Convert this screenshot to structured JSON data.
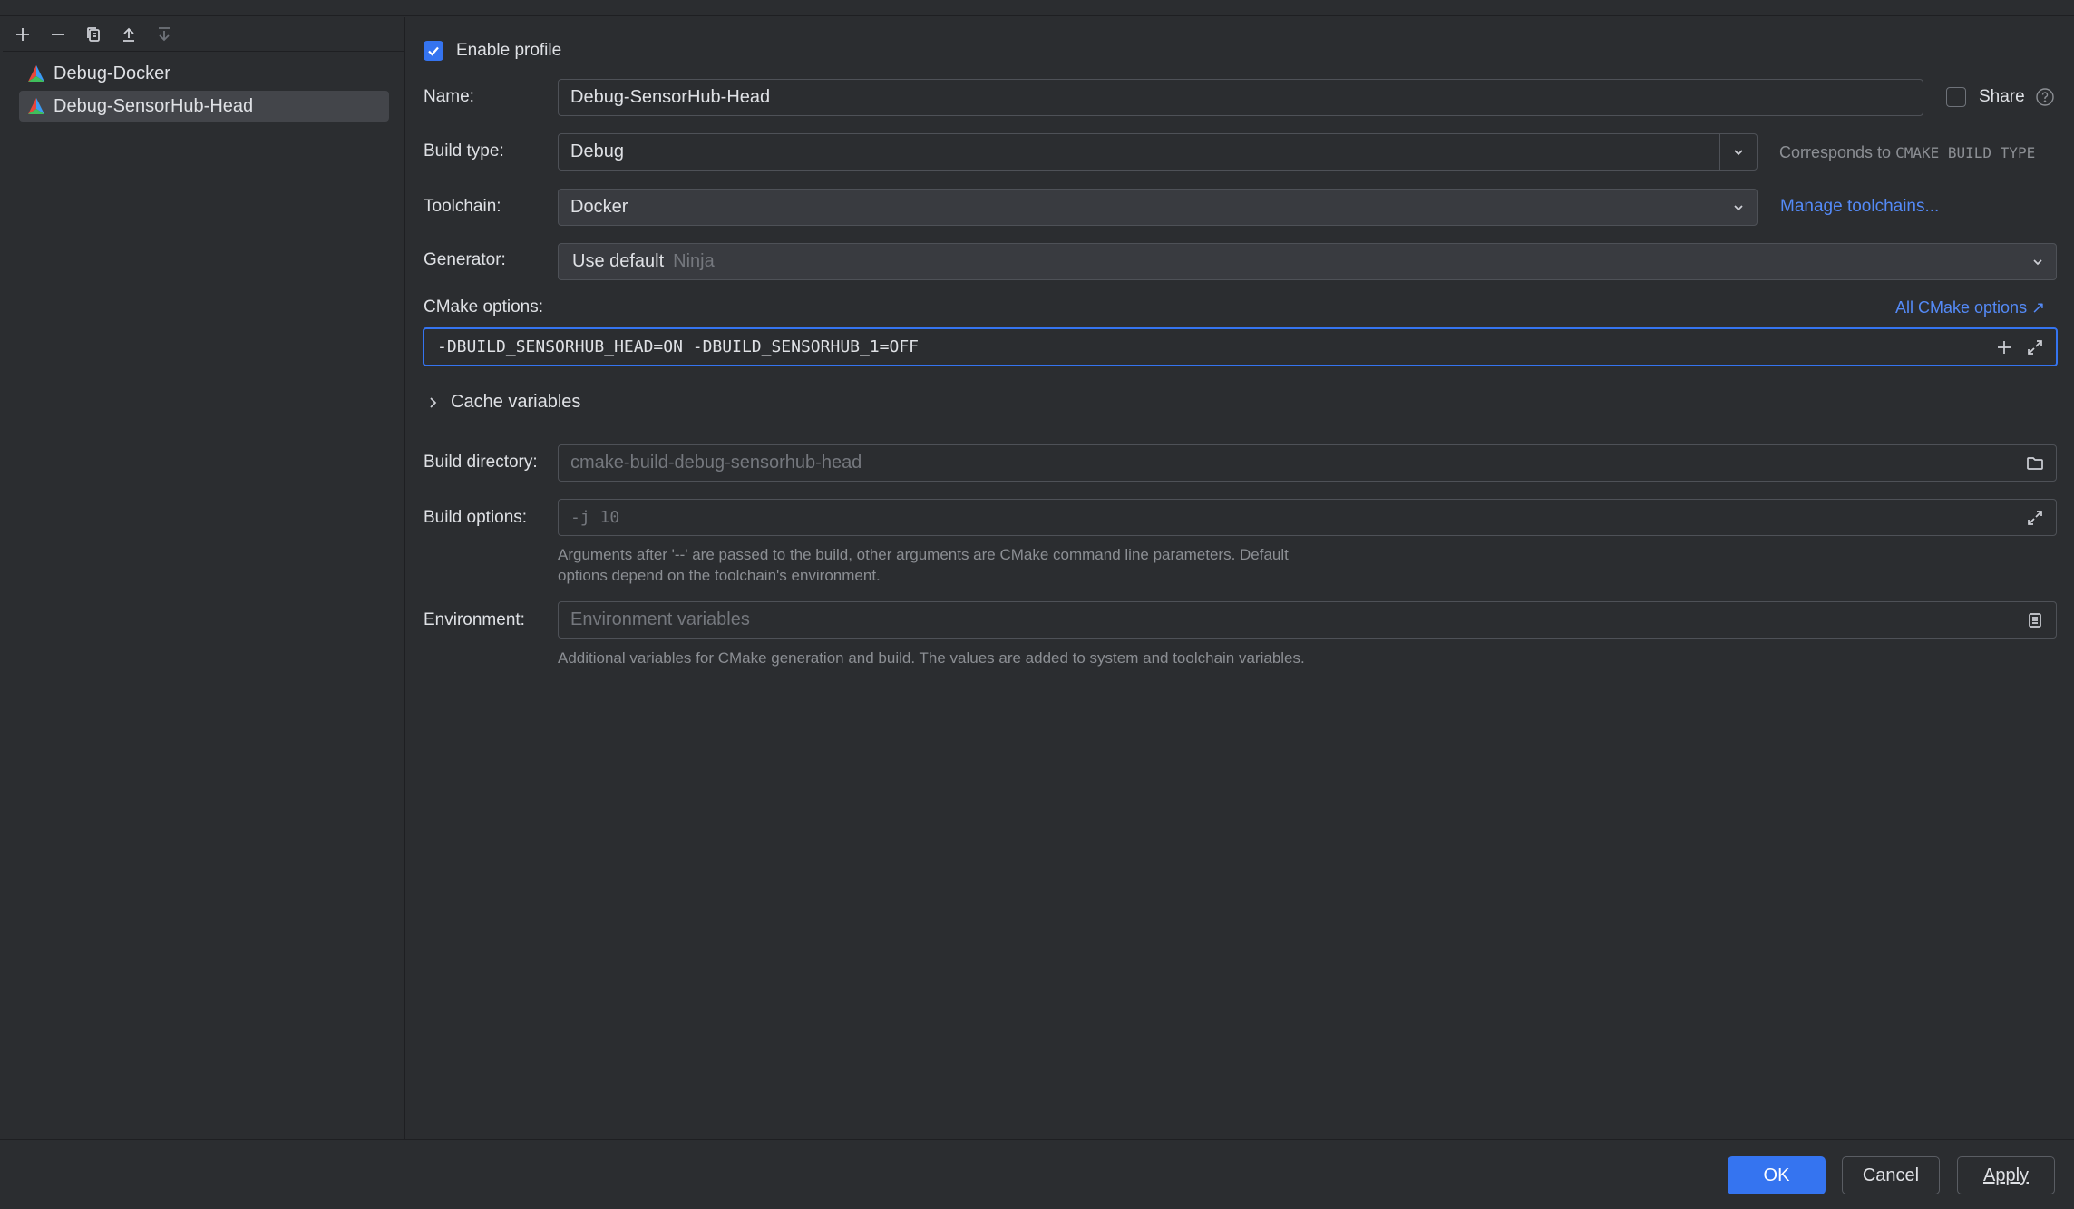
{
  "profiles": [
    {
      "label": "Debug-Docker",
      "selected": false
    },
    {
      "label": "Debug-SensorHub-Head",
      "selected": true
    }
  ],
  "toolbar": {
    "icons": [
      "add-icon",
      "remove-icon",
      "copy-icon",
      "move-up-icon",
      "move-down-icon"
    ]
  },
  "form": {
    "enable_profile_label": "Enable profile",
    "enable_profile_checked": true,
    "name_label": "Name:",
    "name_value": "Debug-SensorHub-Head",
    "share_label": "Share",
    "share_checked": false,
    "build_type_label": "Build type:",
    "build_type_value": "Debug",
    "build_type_hint_prefix": "Corresponds to ",
    "build_type_hint_code": "CMAKE_BUILD_TYPE",
    "toolchain_label": "Toolchain:",
    "toolchain_value": "Docker",
    "manage_toolchains_link": "Manage toolchains...",
    "generator_label": "Generator:",
    "generator_value": "Use default",
    "generator_default": "Ninja",
    "cmake_options_label": "CMake options:",
    "all_cmake_options_link": "All CMake options ↗",
    "cmake_options_value": "-DBUILD_SENSORHUB_HEAD=ON -DBUILD_SENSORHUB_1=OFF",
    "cache_variables_label": "Cache variables",
    "build_directory_label": "Build directory:",
    "build_directory_placeholder": "cmake-build-debug-sensorhub-head",
    "build_options_label": "Build options:",
    "build_options_placeholder": "-j 10",
    "build_options_hint": "Arguments after '--' are passed to the build, other arguments are CMake command line parameters. Default options depend on the toolchain's environment.",
    "environment_label": "Environment:",
    "environment_placeholder": "Environment variables",
    "environment_hint": "Additional variables for CMake generation and build. The values are added to system and toolchain variables."
  },
  "buttons": {
    "ok": "OK",
    "cancel": "Cancel",
    "apply": "Apply"
  },
  "colors": {
    "accent": "#3574f0",
    "link": "#548af7",
    "background": "#2b2d30"
  }
}
